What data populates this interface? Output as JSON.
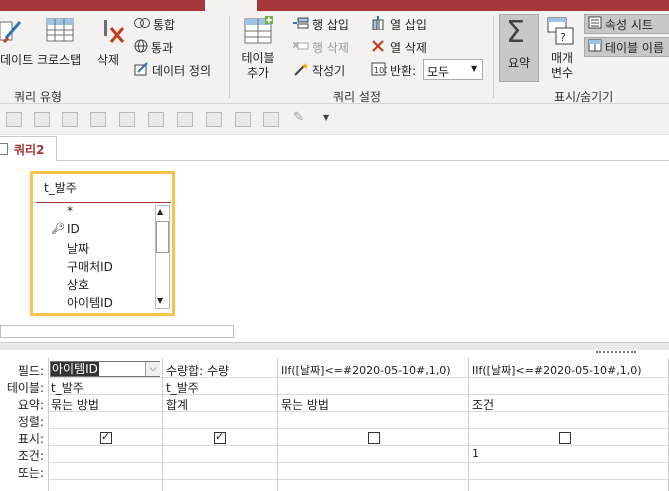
{
  "ribbon": {
    "groups": [
      {
        "label": "쿼리 유형"
      },
      {
        "label": "쿼리 설정"
      },
      {
        "label": "표시/숨기기"
      }
    ],
    "query_type": {
      "update_label": "데이트",
      "crosstab_label": "크로스탭",
      "delete_label": "삭제",
      "union_label": "통합",
      "passthrough_label": "통과",
      "data_def_label": "데이터 정의"
    },
    "query_setup": {
      "add_table_label": "테이블 추가",
      "insert_row_label": "행 삽입",
      "delete_row_label": "행 삭제",
      "builder_label": "작성기",
      "insert_col_label": "열 삽입",
      "delete_col_label": "열 삭제",
      "return_label": "반환:",
      "return_value": "모두"
    },
    "show_hide": {
      "totals_label": "요약",
      "params_label": "매개 변수",
      "property_sheet_label": "속성 시트",
      "table_names_label": "테이블 이름"
    }
  },
  "tab": {
    "label": "쿼리2"
  },
  "table_box": {
    "title": "t_발주",
    "fields": [
      "*",
      "ID",
      "날짜",
      "구매처ID",
      "상호",
      "아이템ID"
    ]
  },
  "grid": {
    "row_labels": [
      "필드:",
      "테이블:",
      "요약:",
      "정렬:",
      "표시:",
      "조건:",
      "또는:"
    ],
    "columns": [
      {
        "field": "아이템ID",
        "table": "t_발주",
        "total": "묶는 방법",
        "sort": "",
        "show": true,
        "criteria": "",
        "or": ""
      },
      {
        "field": "수량합: 수량",
        "table": "t_발주",
        "total": "합계",
        "sort": "",
        "show": true,
        "criteria": "",
        "or": ""
      },
      {
        "field": "IIf([날짜]<=#2020-05-10#,1,0)",
        "table": "",
        "total": "묶는 방법",
        "sort": "",
        "show": false,
        "criteria": "",
        "or": ""
      },
      {
        "field": "IIf([날짜]<=#2020-05-10#,1,0)",
        "table": "",
        "total": "조건",
        "sort": "",
        "show": false,
        "criteria": "1",
        "or": ""
      }
    ]
  },
  "colors": {
    "accent": "#a4373a",
    "table_border": "#f9c34a"
  }
}
